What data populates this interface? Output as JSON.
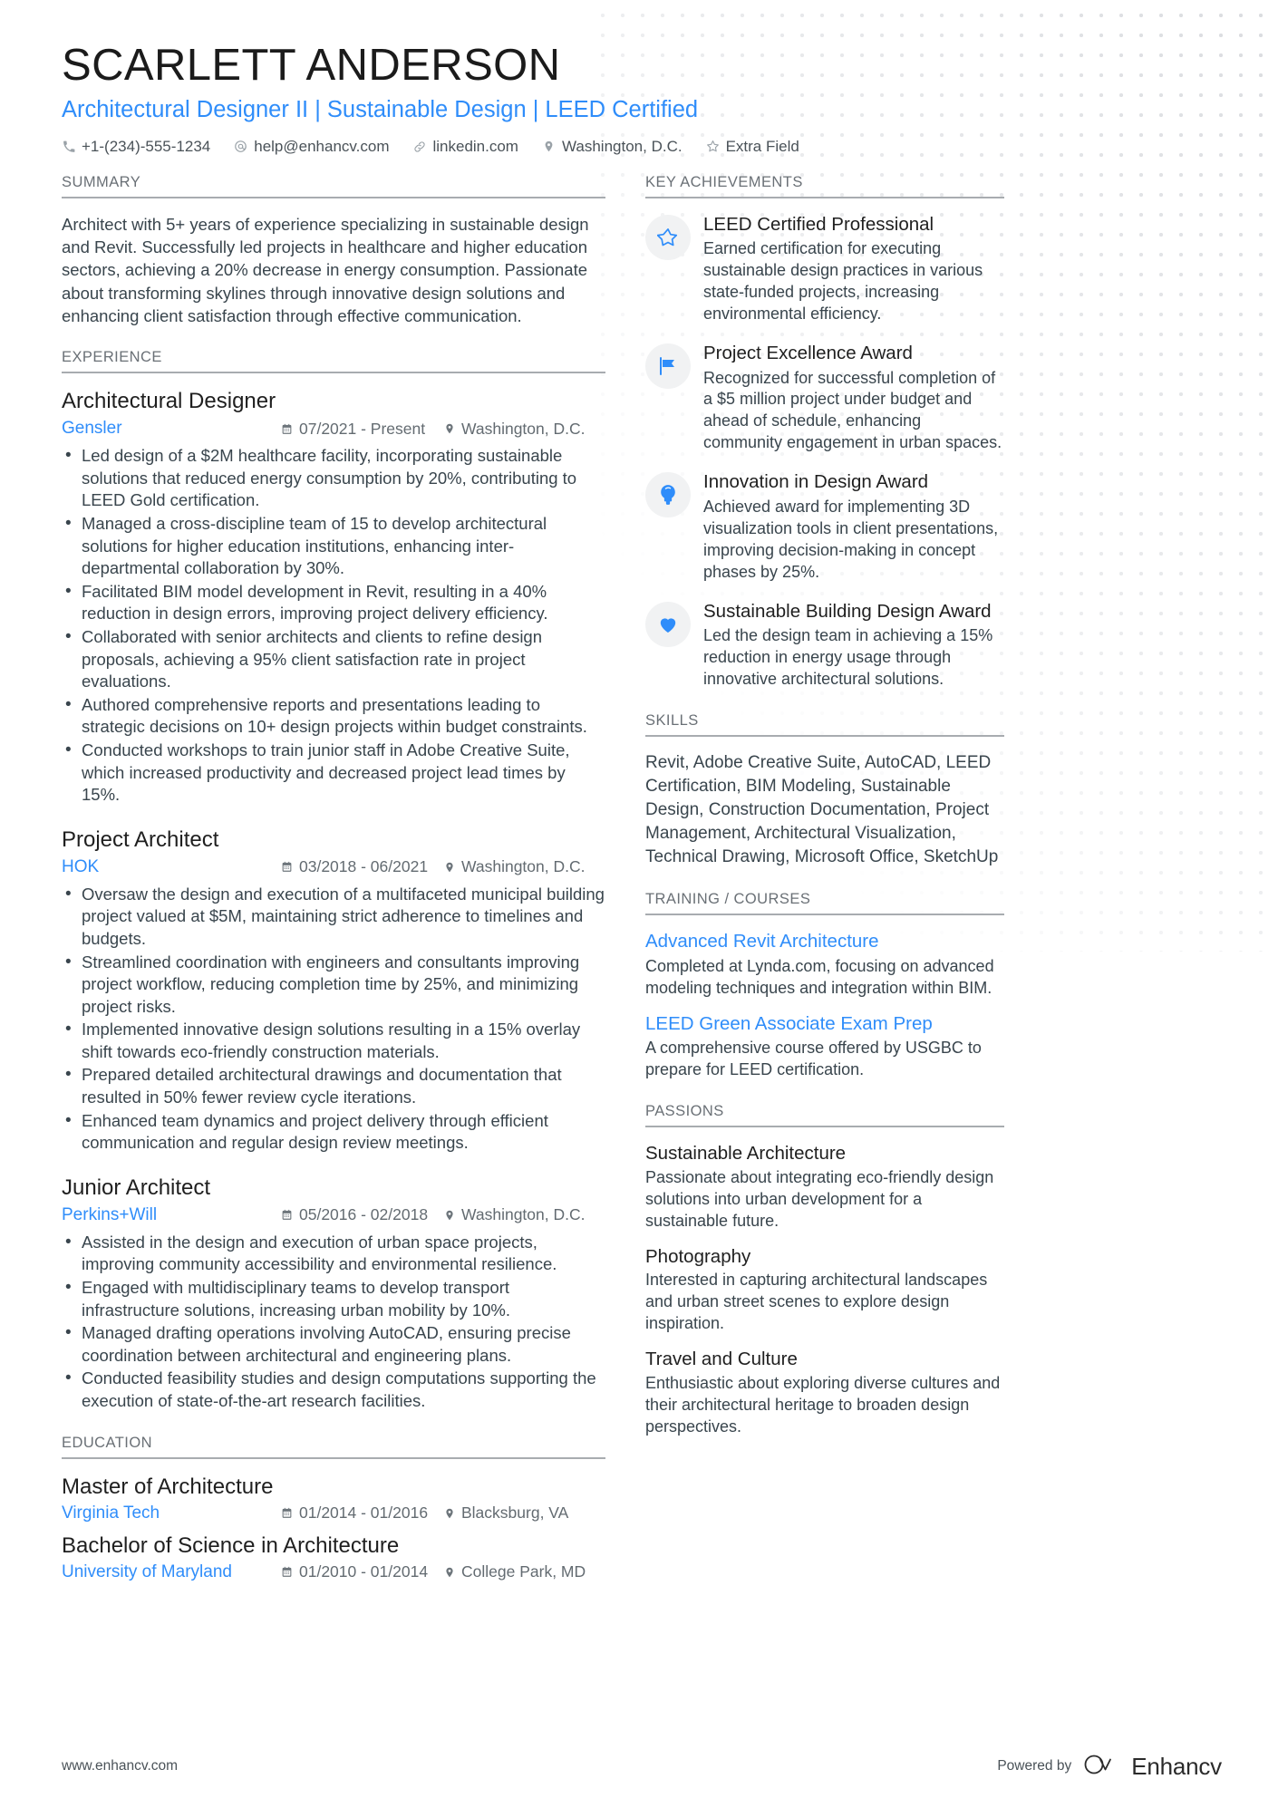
{
  "header": {
    "name": "SCARLETT ANDERSON",
    "headline": "Architectural Designer II | Sustainable Design | LEED Certified",
    "contacts": [
      {
        "icon": "phone-icon",
        "text": "+1-(234)-555-1234"
      },
      {
        "icon": "email-icon",
        "text": "help@enhancv.com"
      },
      {
        "icon": "link-icon",
        "text": "linkedin.com"
      },
      {
        "icon": "location-icon",
        "text": "Washington, D.C."
      },
      {
        "icon": "star-icon",
        "text": "Extra Field"
      }
    ]
  },
  "accent_color": "#2f8dfa",
  "left": {
    "summary": {
      "heading": "SUMMARY",
      "text": "Architect with 5+ years of experience specializing in sustainable design and Revit. Successfully led projects in healthcare and higher education sectors, achieving a 20% decrease in energy consumption. Passionate about transforming skylines through innovative design solutions and enhancing client satisfaction through effective communication."
    },
    "experience": {
      "heading": "EXPERIENCE",
      "jobs": [
        {
          "title": "Architectural Designer",
          "company": "Gensler",
          "dates": "07/2021 - Present",
          "location": "Washington, D.C.",
          "bullets": [
            "Led design of a $2M healthcare facility, incorporating sustainable solutions that reduced energy consumption by 20%, contributing to LEED Gold certification.",
            "Managed a cross-discipline team of 15 to develop architectural solutions for higher education institutions, enhancing inter-departmental collaboration by 30%.",
            "Facilitated BIM model development in Revit, resulting in a 40% reduction in design errors, improving project delivery efficiency.",
            "Collaborated with senior architects and clients to refine design proposals, achieving a 95% client satisfaction rate in project evaluations.",
            "Authored comprehensive reports and presentations leading to strategic decisions on 10+ design projects within budget constraints.",
            "Conducted workshops to train junior staff in Adobe Creative Suite, which increased productivity and decreased project lead times by 15%."
          ]
        },
        {
          "title": "Project Architect",
          "company": "HOK",
          "dates": "03/2018 - 06/2021",
          "location": "Washington, D.C.",
          "bullets": [
            "Oversaw the design and execution of a multifaceted municipal building project valued at $5M, maintaining strict adherence to timelines and budgets.",
            "Streamlined coordination with engineers and consultants improving project workflow, reducing completion time by 25%, and minimizing project risks.",
            "Implemented innovative design solutions resulting in a 15% overlay shift towards eco-friendly construction materials.",
            "Prepared detailed architectural drawings and documentation that resulted in 50% fewer review cycle iterations.",
            "Enhanced team dynamics and project delivery through efficient communication and regular design review meetings."
          ]
        },
        {
          "title": "Junior Architect",
          "company": "Perkins+Will",
          "dates": "05/2016 - 02/2018",
          "location": "Washington, D.C.",
          "bullets": [
            "Assisted in the design and execution of urban space projects, improving community accessibility and environmental resilience.",
            "Engaged with multidisciplinary teams to develop transport infrastructure solutions, increasing urban mobility by 10%.",
            "Managed drafting operations involving AutoCAD, ensuring precise coordination between architectural and engineering plans.",
            "Conducted feasibility studies and design computations supporting the execution of state-of-the-art research facilities."
          ]
        }
      ]
    },
    "education": {
      "heading": "EDUCATION",
      "entries": [
        {
          "degree": "Master of Architecture",
          "school": "Virginia Tech",
          "dates": "01/2014 - 01/2016",
          "location": "Blacksburg, VA"
        },
        {
          "degree": "Bachelor of Science in Architecture",
          "school": "University of Maryland",
          "dates": "01/2010 - 01/2014",
          "location": "College Park, MD"
        }
      ]
    }
  },
  "right": {
    "achievements": {
      "heading": "KEY ACHIEVEMENTS",
      "items": [
        {
          "icon": "star-outline-icon",
          "title": "LEED Certified Professional",
          "desc": "Earned certification for executing sustainable design practices in various state-funded projects, increasing environmental efficiency."
        },
        {
          "icon": "flag-icon",
          "title": "Project Excellence Award",
          "desc": "Recognized for successful completion of a $5 million project under budget and ahead of schedule, enhancing community engagement in urban spaces."
        },
        {
          "icon": "lightbulb-pin-icon",
          "title": "Innovation in Design Award",
          "desc": "Achieved award for implementing 3D visualization tools in client presentations, improving decision-making in concept phases by 25%."
        },
        {
          "icon": "heart-icon",
          "title": "Sustainable Building Design Award",
          "desc": "Led the design team in achieving a 15% reduction in energy usage through innovative architectural solutions."
        }
      ]
    },
    "skills": {
      "heading": "SKILLS",
      "text": "Revit, Adobe Creative Suite, AutoCAD, LEED Certification, BIM Modeling, Sustainable Design, Construction Documentation, Project Management, Architectural Visualization, Technical Drawing, Microsoft Office, SketchUp"
    },
    "training": {
      "heading": "TRAINING / COURSES",
      "courses": [
        {
          "title": "Advanced Revit Architecture",
          "desc": "Completed at Lynda.com, focusing on advanced modeling techniques and integration within BIM."
        },
        {
          "title": "LEED Green Associate Exam Prep",
          "desc": "A comprehensive course offered by USGBC to prepare for LEED certification."
        }
      ]
    },
    "passions": {
      "heading": "PASSIONS",
      "items": [
        {
          "title": "Sustainable Architecture",
          "desc": "Passionate about integrating eco-friendly design solutions into urban development for a sustainable future."
        },
        {
          "title": "Photography",
          "desc": "Interested in capturing architectural landscapes and urban street scenes to explore design inspiration."
        },
        {
          "title": "Travel and Culture",
          "desc": "Enthusiastic about exploring diverse cultures and their architectural heritage to broaden design perspectives."
        }
      ]
    }
  },
  "footer": {
    "url": "www.enhancv.com",
    "powered_by": "Powered by",
    "brand": "Enhancv"
  }
}
